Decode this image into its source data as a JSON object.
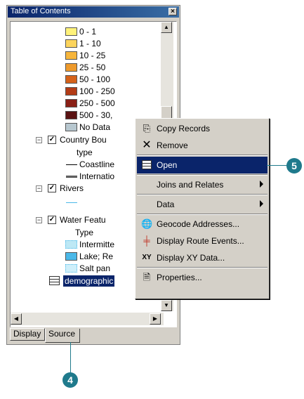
{
  "window": {
    "title": "Table of Contents",
    "close_glyph": "×"
  },
  "legend_ranges": [
    {
      "label": "0 - 1",
      "color": "#fff27a"
    },
    {
      "label": "1 - 10",
      "color": "#fcd45c"
    },
    {
      "label": "10 - 25",
      "color": "#f6b53c"
    },
    {
      "label": "25 - 50",
      "color": "#ee9a2c"
    },
    {
      "label": "50 - 100",
      "color": "#d5621a"
    },
    {
      "label": "100 - 250",
      "color": "#b33c16"
    },
    {
      "label": "250 - 500",
      "color": "#8a2016"
    },
    {
      "label": "500 - 30,",
      "color": "#5a1212"
    },
    {
      "label": "No Data",
      "color": "#b7c7cf"
    }
  ],
  "layers": {
    "country": {
      "label": "Country Bou",
      "field": "type",
      "items": [
        "Coastline",
        "Internatio"
      ]
    },
    "rivers": {
      "label": "Rivers"
    },
    "water": {
      "label": "Water Featu",
      "field": "Type",
      "items": [
        {
          "label": "Intermitte",
          "color": "#bde8f5"
        },
        {
          "label": "Lake; Re",
          "color": "#4ab8e8"
        },
        {
          "label": "Salt pan",
          "color": "#cfeffa"
        }
      ]
    },
    "table": {
      "label": "demographic"
    }
  },
  "tabs": {
    "display": "Display",
    "source": "Source"
  },
  "context_menu": {
    "copy_records": "Copy Records",
    "remove": "Remove",
    "open": "Open",
    "joins": "Joins and Relates",
    "data": "Data",
    "geocode": "Geocode Addresses...",
    "route_events": "Display Route Events...",
    "xy_data": "Display XY Data...",
    "properties": "Properties..."
  },
  "callouts": {
    "open_step": "5",
    "source_step": "4"
  },
  "colors": {
    "callout": "#1f7a8c",
    "selection": "#0a246a"
  }
}
